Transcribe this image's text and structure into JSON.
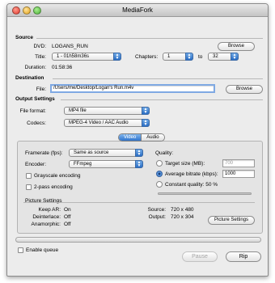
{
  "window": {
    "title": "MediaFork"
  },
  "source": {
    "heading": "Source",
    "dvd_label": "DVD:",
    "dvd_value": "LOGANS_RUN",
    "browse": "Browse",
    "title_label": "Title:",
    "title_value": "1 - 01h58m36s",
    "chapters_label": "Chapters:",
    "chapter_from": "1",
    "to_label": "to",
    "chapter_to": "32",
    "duration_label": "Duration:",
    "duration_value": "01:58:36"
  },
  "destination": {
    "heading": "Destination",
    "file_label": "File:",
    "file_value": "/Users/me/Desktop/Logan's Run.m4v",
    "browse": "Browse"
  },
  "output": {
    "heading": "Output Settings",
    "format_label": "File format:",
    "format_value": "MP4 file",
    "codecs_label": "Codecs:",
    "codecs_value": "MPEG-4 Video / AAC Audio"
  },
  "tabs": {
    "video": "Video",
    "audio": "Audio"
  },
  "video": {
    "framerate_label": "Framerate (fps):",
    "framerate_value": "Same as source",
    "encoder_label": "Encoder:",
    "encoder_value": "FFmpeg",
    "grayscale": "Grayscale encoding",
    "twopass": "2-pass encoding",
    "quality_label": "Quality:",
    "target_size": "Target size (MB):",
    "target_size_value": "700",
    "avg_bitrate": "Average bitrate (kbps):",
    "avg_bitrate_value": "1000",
    "constant_quality": "Constant quality: 50 %",
    "quality_slider_fraction": 0.5
  },
  "picture": {
    "heading": "Picture Settings",
    "keep_ar_label": "Keep AR:",
    "keep_ar_value": "On",
    "deinterlace_label": "Deinterlace:",
    "deinterlace_value": "Off",
    "anamorphic_label": "Anamorphic:",
    "anamorphic_value": "Off",
    "source_label": "Source:",
    "source_value": "720 x 480",
    "output_label": "Output:",
    "output_value": "720 x 304",
    "button": "Picture Settings"
  },
  "footer": {
    "enable_queue": "Enable queue",
    "pause": "Pause",
    "rip": "Rip"
  },
  "colors": {
    "accent": "#2f74cc",
    "window_bg": "#ececec"
  }
}
